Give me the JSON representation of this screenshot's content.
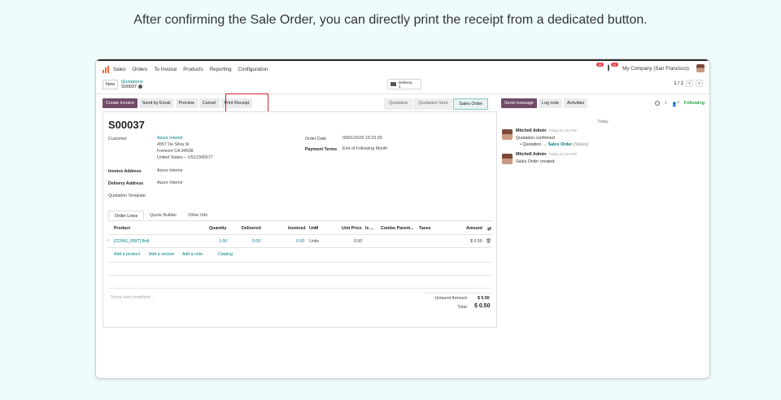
{
  "caption": "After confirming the Sale Order, you can directly print the receipt from a dedicated button.",
  "topnav": {
    "app_name": "Sales",
    "menu": [
      "Orders",
      "To Invoice",
      "Products",
      "Reporting",
      "Configuration"
    ],
    "chat_badge": "15",
    "activity_badge": "21",
    "company": "My Company (San Francisco)"
  },
  "control": {
    "new_label": "New",
    "breadcrumb_parent": "Quotations",
    "breadcrumb_current": "S00037",
    "delivery_label": "Delivery",
    "delivery_count": "1",
    "pager": "1 / 1"
  },
  "actions": [
    "Create Invoice",
    "Send by Email",
    "Preview",
    "Cancel",
    "Print Receipt"
  ],
  "stages": [
    "Quotation",
    "Quotation Sent",
    "Sales Order"
  ],
  "active_stage": "Sales Order",
  "form": {
    "order_name": "S00037",
    "customer_label": "Customer",
    "customer_name": "Azure Interior",
    "customer_address": [
      "4557 De Silva St",
      "Fremont CA 94538",
      "United States – US12345677"
    ],
    "order_date_label": "Order Date",
    "order_date": "09/01/2025 15:23:29",
    "payment_terms_label": "Payment Terms",
    "payment_terms": "End of Following Month",
    "invoice_address_label": "Invoice Address",
    "invoice_address": "Azure Interior",
    "delivery_address_label": "Delivery Address",
    "delivery_address": "Azure Interior",
    "quotation_template_label": "Quotation Template"
  },
  "tabs": [
    "Order Lines",
    "Quote Builder",
    "Other Info"
  ],
  "table": {
    "headers": {
      "product": "Product",
      "quantity": "Quantity",
      "delivered": "Delivered",
      "invoiced": "Invoiced",
      "uom": "UoM",
      "unit_price": "Unit Price",
      "is": "Is ...",
      "combo": "Combo Parent...",
      "taxes": "Taxes",
      "amount": "Amount"
    },
    "row": {
      "product": "[CONS_0097] Bolt",
      "quantity": "1.00",
      "delivered": "0.00",
      "invoiced": "0.00",
      "uom": "Units",
      "unit_price": "0.50",
      "amount": "$ 0.50"
    },
    "add_links": [
      "Add a product",
      "Add a section",
      "Add a note",
      "Catalog"
    ]
  },
  "footer": {
    "terms_placeholder": "Terms and conditions...",
    "untaxed_label": "Untaxed Amount:",
    "untaxed_value": "$ 0.50",
    "total_label": "Total:",
    "total_value": "$ 0.50"
  },
  "chatter": {
    "buttons": [
      "Send message",
      "Log note",
      "Activities"
    ],
    "followers_count": "2",
    "following_label": "Following",
    "today_label": "Today",
    "messages": [
      {
        "author": "Mitchell Admin",
        "time": "Today at 3:23 PM",
        "text": "Quotation confirmed",
        "tracking_old": "Quotation",
        "tracking_arrow": "→",
        "tracking_new": "Sales Order",
        "tracking_field": "(Status)"
      },
      {
        "author": "Mitchell Admin",
        "time": "Today at 3:23 PM",
        "text": "Sales Order created"
      }
    ]
  },
  "colors": {
    "brand": "#714b67",
    "link": "#017e84",
    "highlight": "#d0202c",
    "page_bg": "#effcfd"
  }
}
